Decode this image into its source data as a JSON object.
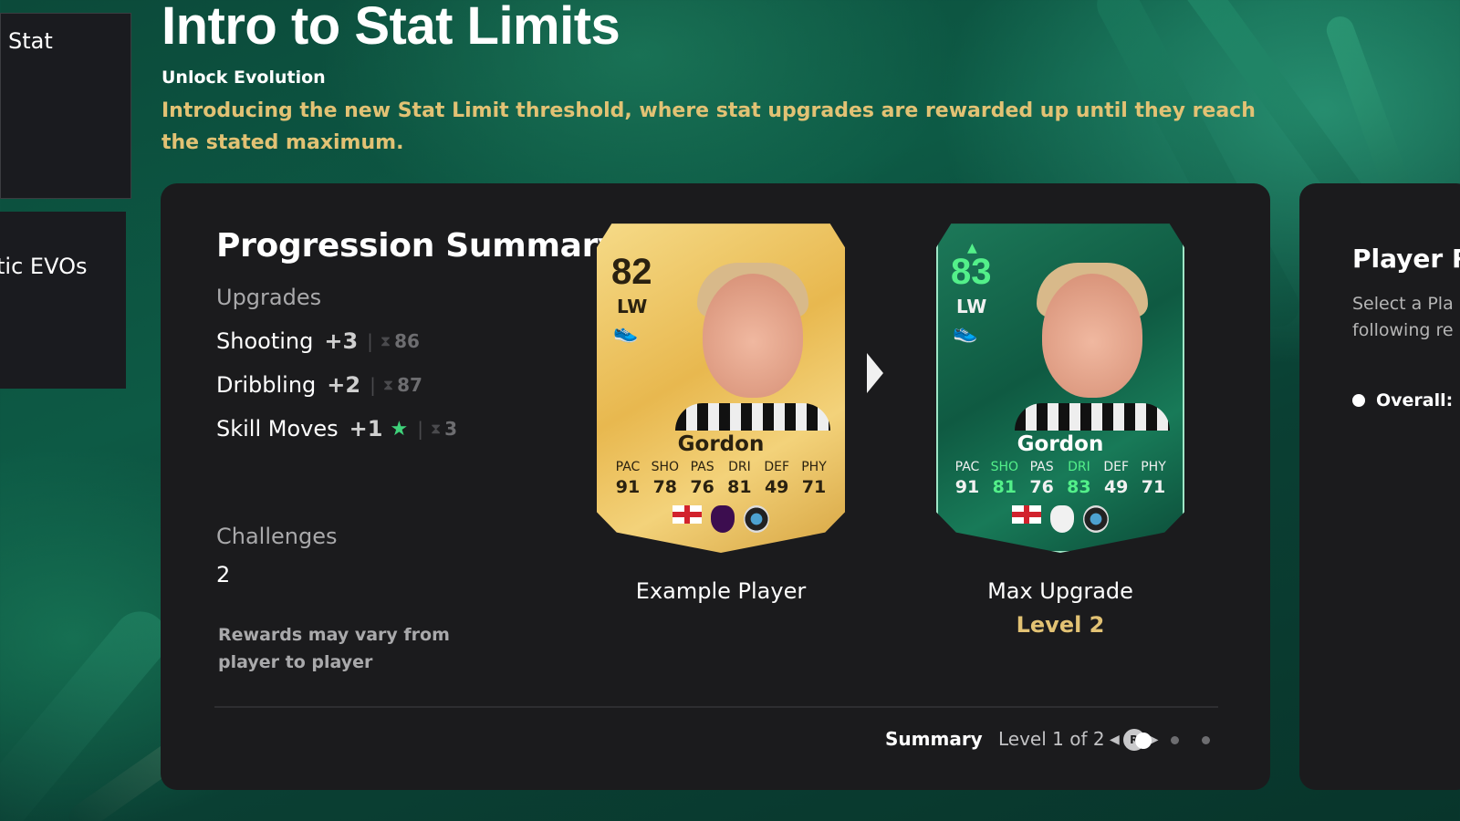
{
  "sidebar": {
    "tiles": [
      {
        "label": "Stat"
      },
      {
        "label": "tic EVOs"
      }
    ]
  },
  "header": {
    "title": "Intro to Stat Limits",
    "subtitle": "Unlock Evolution",
    "description": "Introducing the new Stat Limit threshold, where stat upgrades are rewarded up until they reach the stated maximum."
  },
  "summary": {
    "title": "Progression Summary",
    "upgrades_label": "Upgrades",
    "upgrades": [
      {
        "name": "Shooting",
        "plus": "+3",
        "cap": "86"
      },
      {
        "name": "Dribbling",
        "plus": "+2",
        "cap": "87"
      },
      {
        "name": "Skill Moves",
        "plus": "+1",
        "cap": "3",
        "star": true
      }
    ],
    "challenges_label": "Challenges",
    "challenges_value": "2",
    "rewards_note": "Rewards may vary from player to player"
  },
  "cards": {
    "example": {
      "rating": "82",
      "position": "LW",
      "name": "Gordon",
      "stats": [
        {
          "label": "PAC",
          "value": "91"
        },
        {
          "label": "SHO",
          "value": "78"
        },
        {
          "label": "PAS",
          "value": "76"
        },
        {
          "label": "DRI",
          "value": "81"
        },
        {
          "label": "DEF",
          "value": "49"
        },
        {
          "label": "PHY",
          "value": "71"
        }
      ],
      "caption": "Example Player"
    },
    "max": {
      "rating": "83",
      "position": "LW",
      "name": "Gordon",
      "stats": [
        {
          "label": "PAC",
          "value": "91"
        },
        {
          "label": "SHO",
          "value": "81",
          "upgraded": true
        },
        {
          "label": "PAS",
          "value": "76"
        },
        {
          "label": "DRI",
          "value": "83",
          "upgraded": true
        },
        {
          "label": "DEF",
          "value": "49"
        },
        {
          "label": "PHY",
          "value": "71"
        }
      ],
      "caption": "Max Upgrade",
      "level": "Level 2"
    }
  },
  "footer": {
    "summary_label": "Summary",
    "level_label": "Level 1 of 2",
    "r_button": "R",
    "pages": 3,
    "active_page": 0
  },
  "right_panel": {
    "title": "Player R",
    "desc_line1": "Select a Pla",
    "desc_line2": "following re",
    "bullet": "Overall:"
  },
  "colors": {
    "accent_gold": "#e2c274",
    "upgrade_green": "#53f08a",
    "panel_bg": "#1b1b1d"
  }
}
